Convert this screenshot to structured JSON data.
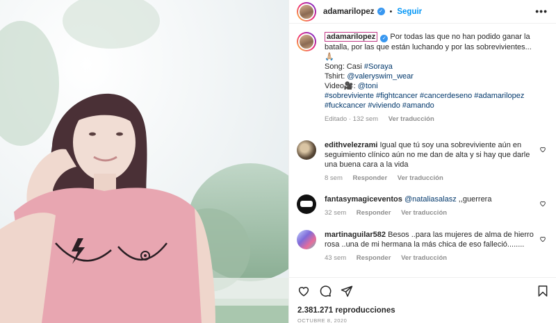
{
  "post": {
    "username": "adamarilopez",
    "follow_label": "Seguir",
    "more_label": "•••",
    "separator": "•"
  },
  "caption": {
    "username": "adamarilopez",
    "line1": "Por todas las que no han podido ganar la batalla, por las que están luchando y por las sobrevivientes...",
    "emoji": "🙏🏼",
    "song_label": "Song: Casi ",
    "song_tag": "#Soraya",
    "tshirt_label": "Tshirt: ",
    "tshirt_tag": "@valeryswim_wear",
    "video_label": "Video🎥: ",
    "video_tag": "@toni",
    "hashtags": "#sobreviviente #fightcancer #cancerdeseno #adamarilopez #fuckcancer #viviendo #amando",
    "edited": "Editado · 132 sem",
    "translate": "Ver traducción"
  },
  "comments": [
    {
      "username": "edithvelezrami",
      "text": "Igual que tú soy una sobreviviente aún en seguimiento clínico aún no me dan de alta y si hay que darle una buena cara a la vida",
      "age": "8 sem",
      "reply": "Responder",
      "translate": "Ver traducción"
    },
    {
      "username": "fantasymagiceventos",
      "mention": "@nataliasalasz",
      "text": " ,,guerrera",
      "age": "32 sem",
      "reply": "Responder",
      "translate": "Ver traducción"
    },
    {
      "username": "martinaguilar582",
      "text": "Besos ..para las mujeres de alma de hierro rosa ..una de mi hermana la más chica de eso falleció........",
      "age": "43 sem",
      "reply": "Responder",
      "translate": "Ver traducción"
    }
  ],
  "stats": {
    "views": "2.381.271 reproducciones",
    "date": "OCTUBRE 8, 2020"
  },
  "icons": {
    "like": "heart-icon",
    "comment": "comment-icon",
    "share": "share-icon",
    "save": "bookmark-icon",
    "verified": "verified-badge-icon",
    "more": "more-options-icon"
  },
  "colors": {
    "accent": "#0095f6",
    "verified": "#3897f0",
    "muted": "#8e8e8e",
    "text": "#262626"
  }
}
